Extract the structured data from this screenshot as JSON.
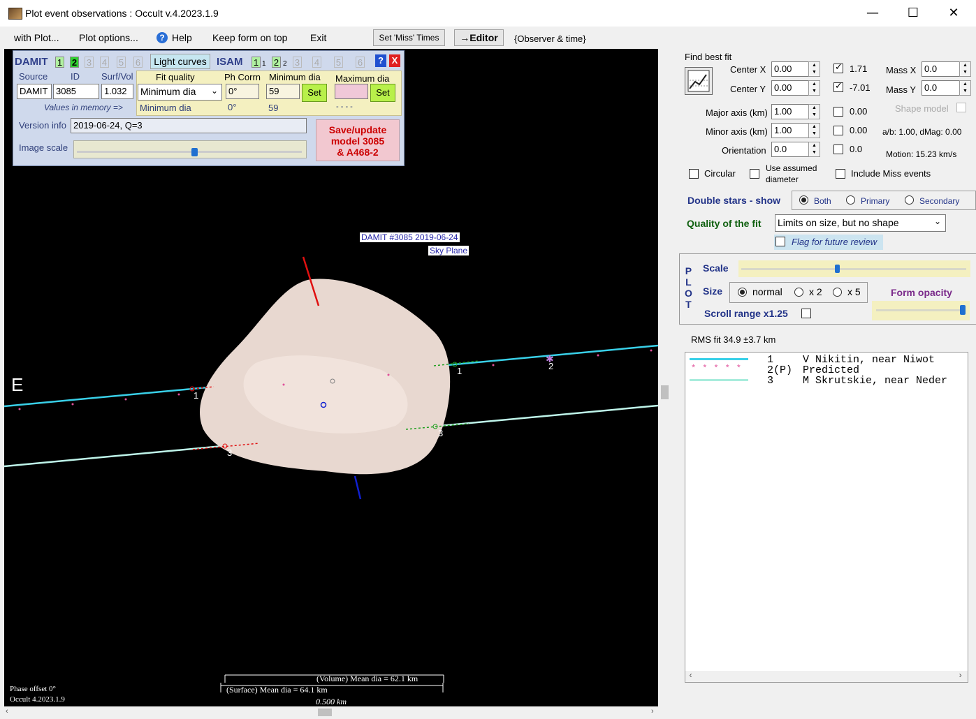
{
  "window": {
    "title": "Plot event observations : Occult v.4.2023.1.9",
    "minimize": "—",
    "maximize": "☐",
    "close": "✕"
  },
  "menu": {
    "with_plot": "with Plot...",
    "plot_options": "Plot options...",
    "help": "Help",
    "keep_on_top": "Keep form on top",
    "exit": "Exit",
    "set_miss_times": "Set 'Miss' Times",
    "editor": "→Editor",
    "observer_time": "{Observer & time}"
  },
  "damit": {
    "label": "DAMIT",
    "nums": [
      "1",
      "2",
      "3",
      "4",
      "5",
      "6"
    ],
    "light_curves": "Light curves",
    "isam": "ISAM",
    "isam_nums": [
      "1",
      "1",
      "2",
      "2",
      "3",
      "4",
      "5",
      "6"
    ],
    "help": "?",
    "close": "X",
    "source_label": "Source",
    "id_label": "ID",
    "surfvol_label": "Surf/Vol",
    "source": "DAMIT",
    "id": "3085",
    "surfvol": "1.032",
    "fit_quality_label": "Fit quality",
    "ph_corrn_label": "Ph Corrn",
    "min_dia_label": "Minimum dia",
    "max_dia_label": "Maximum dia",
    "fit_quality": "Minimum dia",
    "ph_corrn": "0°",
    "min_dia": "59",
    "max_dia": "",
    "set": "Set",
    "values_label": "Values in memory =>",
    "mem_fit": "Minimum dia",
    "mem_ph": "0°",
    "mem_min": "59",
    "mem_max": "- - - -",
    "version_label": "Version info",
    "version": "2019-06-24, Q=3",
    "image_scale_label": "Image scale",
    "save_line1": "Save/update",
    "save_line2": "model 3085",
    "save_line3": "& A468-2"
  },
  "plot": {
    "title_line1": "DAMIT #3085 2019-06-24",
    "title_line2": "Sky Plane",
    "east": "E",
    "chord_labels": [
      "1",
      "1",
      "2",
      "3",
      "3"
    ],
    "scale_volume": "(Volume) Mean dia = 62.1 km",
    "scale_surface": "(Surface) Mean dia = 64.1 km",
    "scale_bar": "0.500 km",
    "phase": "Phase offset 0°",
    "version": "Occult 4.2023.1.9"
  },
  "fit": {
    "find_best_fit": "Find best fit",
    "center_x_label": "Center X",
    "center_x": "0.00",
    "center_y_label": "Center Y",
    "center_y": "0.00",
    "major_label": "Major axis (km)",
    "major": "1.00",
    "minor_label": "Minor axis (km)",
    "minor": "1.00",
    "orient_label": "Orientation",
    "orient": "0.0",
    "chk1": "1.71",
    "chk2": "-7.01",
    "chk3": "0.00",
    "chk4": "0.00",
    "chk5": "0.0",
    "massx_label": "Mass X",
    "massx": "0.0",
    "massy_label": "Mass Y",
    "massy": "0.0",
    "shape_model": "Shape model",
    "ab": "a/b: 1.00, dMag: 0.00",
    "motion": "Motion: 15.23 km/s",
    "circular": "Circular",
    "assumed_line1": "Use assumed",
    "assumed_line2": "diameter",
    "include_miss": "Include Miss events",
    "double_stars": "Double stars - show",
    "both": "Both",
    "primary": "Primary",
    "secondary": "Secondary",
    "quality_label": "Quality of the fit",
    "quality": "Limits on size, but no shape",
    "flag": "Flag for future review"
  },
  "plotpanel": {
    "plot_letters": [
      "P",
      "L",
      "O",
      "T"
    ],
    "scale": "Scale",
    "size": "Size",
    "normal": "normal",
    "x2": "x 2",
    "x5": "x 5",
    "form_opacity": "Form opacity",
    "scroll_range": "Scroll range x1.25"
  },
  "rms": "RMS fit 34.9 ±3.7 km",
  "legend": [
    {
      "num": "1",
      "text": "V Nikitin, near Niwot"
    },
    {
      "num": "2(P)",
      "text": "Predicted"
    },
    {
      "num": "3",
      "text": "M Skrutskie, near Neder"
    }
  ],
  "colors": {
    "chord1": "#39d0e8",
    "chord3": "#bff5ea",
    "predicted": "#e0509a",
    "asteroid": "#e8d8d0",
    "north": "#e01010",
    "south": "#1020d0"
  }
}
